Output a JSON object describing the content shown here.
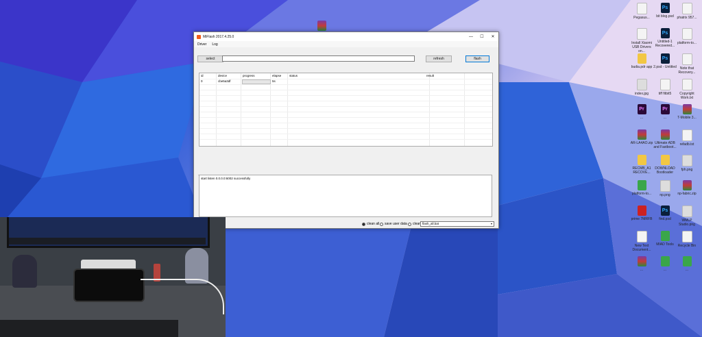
{
  "desktop": {
    "icons": [
      {
        "label": "Pegasus...",
        "kind": "doc"
      },
      {
        "label": "bit blog.psd",
        "kind": "ps"
      },
      {
        "label": "phatrix 957...",
        "kind": "doc"
      },
      {
        "label": "Install Xiaomi USB Drivers on...",
        "kind": "doc"
      },
      {
        "label": "Untitled-1 Recovered...",
        "kind": "ps"
      },
      {
        "label": "platform-to...",
        "kind": "doc"
      },
      {
        "label": "budia.pdr app",
        "kind": "folder"
      },
      {
        "label": "2.psd - Untitled",
        "kind": "ps"
      },
      {
        "label": "Note that Recovery...",
        "kind": "doc"
      },
      {
        "label": "index.jpg",
        "kind": "png"
      },
      {
        "label": "tiff fitbit5",
        "kind": "doc"
      },
      {
        "label": "Copyright Work.txt",
        "kind": "doc"
      },
      {
        "label": "...",
        "kind": "pr"
      },
      {
        "label": "...",
        "kind": "pr"
      },
      {
        "label": "T-Mobile 3...",
        "kind": "rar"
      },
      {
        "label": "AR-LA4AO.zip",
        "kind": "rar"
      },
      {
        "label": "Ultimate ADB and Fastboot...",
        "kind": "rar"
      },
      {
        "label": "refadb.txt",
        "kind": "doc"
      },
      {
        "label": "RECMB_A1 RECOVE...",
        "kind": "folder"
      },
      {
        "label": "DOWNLOAD Bootloader",
        "kind": "folder"
      },
      {
        "label": "fph.png",
        "kind": "png"
      },
      {
        "label": "platform-to...",
        "kind": "green"
      },
      {
        "label": "np.png",
        "kind": "png"
      },
      {
        "label": "np-fabric.zip",
        "kind": "rar"
      },
      {
        "label": "prime 7MRFB",
        "kind": "red"
      },
      {
        "label": "find.psd",
        "kind": "ps"
      },
      {
        "label": "WMLP Studio.png",
        "kind": "png"
      },
      {
        "label": "New Text Document...",
        "kind": "doc"
      },
      {
        "label": "MIAD Tools",
        "kind": "green"
      },
      {
        "label": "Recycle Bin",
        "kind": "doc"
      },
      {
        "label": "...",
        "kind": "rar"
      },
      {
        "label": "...",
        "kind": "green"
      },
      {
        "label": "...",
        "kind": "green"
      }
    ]
  },
  "app": {
    "title": "MiFlash 2017.4.25.0",
    "window_controls": {
      "minimize": "—",
      "maximize": "☐",
      "close": "✕"
    },
    "menu": [
      "Driver",
      "Log"
    ],
    "toolbar": {
      "select_label": "select",
      "path_value": "",
      "refresh_label": "refresh",
      "flash_label": "flash"
    },
    "table": {
      "columns": [
        "id",
        "device",
        "progress",
        "elapse",
        "status",
        "result"
      ],
      "rows": [
        {
          "id": "0",
          "device": "cbe5a3df",
          "progress": 0,
          "elapse": "5s",
          "status": "",
          "result": ""
        }
      ]
    },
    "log": {
      "lines": [
        "start listen 0.0.0.0:6002 successfully"
      ]
    },
    "options": {
      "clean_all": "clean all",
      "save_user_data": "save user data",
      "clean_all_and_lock": "clean all and lock",
      "selected": "clean_all",
      "script_value": "flash_all.bat"
    }
  },
  "colors": {
    "app_icon": "#f25c19",
    "focus_border": "#0078d7"
  }
}
